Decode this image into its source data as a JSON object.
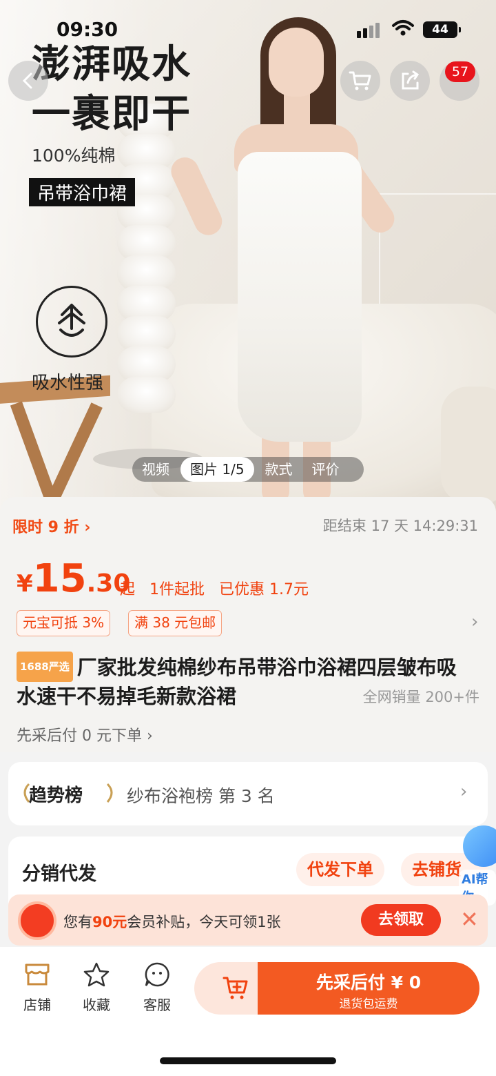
{
  "status_bar": {
    "time": "09:30",
    "battery": "44"
  },
  "header": {
    "cart_badge": "57"
  },
  "hero": {
    "headline_line1": "澎湃吸水",
    "headline_line2": "一裹即干",
    "cotton": "100%纯棉",
    "product_tag": "吊带浴巾裙",
    "feature": "吸水性强"
  },
  "media_tabs": [
    {
      "label": "视频"
    },
    {
      "label": "图片 1/5"
    },
    {
      "label": "款式"
    },
    {
      "label": "评价"
    }
  ],
  "promo": {
    "flash_sale": "限时 9 折",
    "countdown_label": "距结束",
    "countdown_value": "17 天 14:29:31"
  },
  "price": {
    "currency": "¥",
    "integer": "15",
    "decimal": ".30",
    "suffix": "起",
    "min_order": "1件起批",
    "discount": "已优惠 1.7元"
  },
  "coupons": [
    {
      "label": "元宝可抵 3%"
    },
    {
      "label": "满 38 元包邮"
    }
  ],
  "product": {
    "brand_tag": "1688严选",
    "title": "厂家批发纯棉纱布吊带浴巾浴裙四层皱布吸水速干不易掉毛新款浴裙",
    "sales": "全网销量 200+件",
    "pay_later": "先采后付 0 元下单"
  },
  "trend": {
    "title": "趋势榜",
    "rank_text": "纱布浴袍榜  第 3 名"
  },
  "distribution": {
    "title": "分销代发",
    "btn_dropship": "代发下单",
    "btn_stock": "去铺货"
  },
  "ai_helper": {
    "label": "AI帮你"
  },
  "banner": {
    "prefix": "您有",
    "amount": "90元",
    "suffix": "会员补贴，今天可领1张",
    "claim": "去领取"
  },
  "bottom_nav": {
    "shop": "店铺",
    "favorite": "收藏",
    "service": "客服",
    "buy_main": "先采后付 ¥ 0",
    "buy_sub": "退货包运费"
  }
}
